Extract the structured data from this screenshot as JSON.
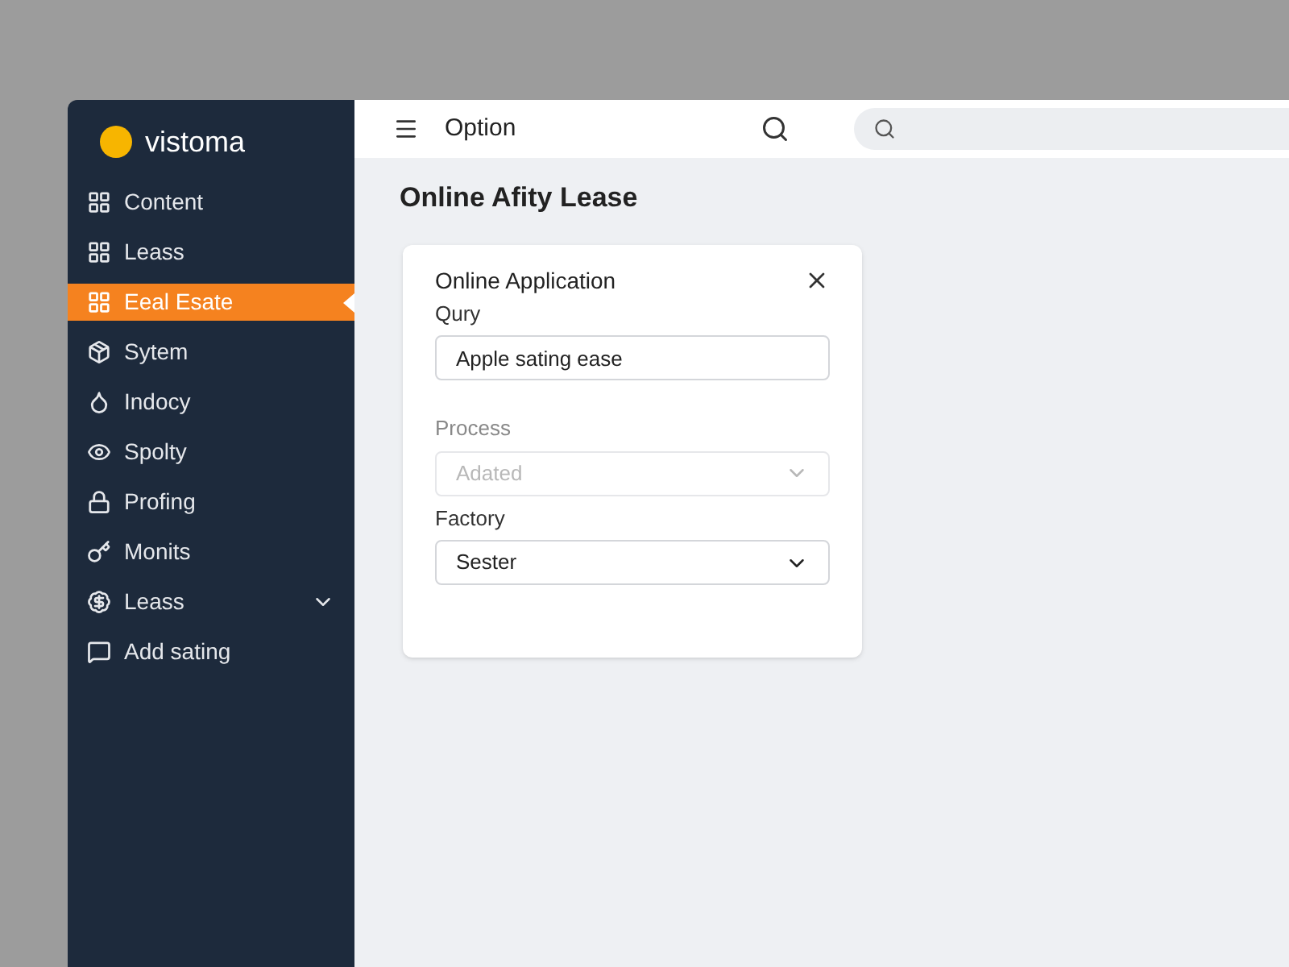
{
  "brand": {
    "name": "vistoma"
  },
  "sidebar": {
    "items": [
      {
        "label": "Content",
        "selected": false
      },
      {
        "label": "Leass",
        "selected": false
      },
      {
        "label": "Eeal Esate",
        "selected": true
      },
      {
        "label": "Sytem",
        "selected": false
      },
      {
        "label": "Indocy",
        "selected": false
      },
      {
        "label": "Spolty",
        "selected": false
      },
      {
        "label": "Profing",
        "selected": false
      },
      {
        "label": "Monits",
        "selected": false
      },
      {
        "label": "Leass",
        "selected": false,
        "expanded": false
      },
      {
        "label": "Add sating",
        "selected": false
      }
    ]
  },
  "header": {
    "title": "Option"
  },
  "page_title": "Online Afity Lease",
  "dialog": {
    "title": "Online Application",
    "fields": [
      {
        "kind": "text",
        "label": "Qury",
        "value": "Apple sating ease",
        "disabled": false
      },
      {
        "kind": "select",
        "label": "Process",
        "value": "Adated",
        "disabled": true
      },
      {
        "kind": "select",
        "label": "Factory",
        "value": "Sester",
        "disabled": false
      }
    ]
  }
}
